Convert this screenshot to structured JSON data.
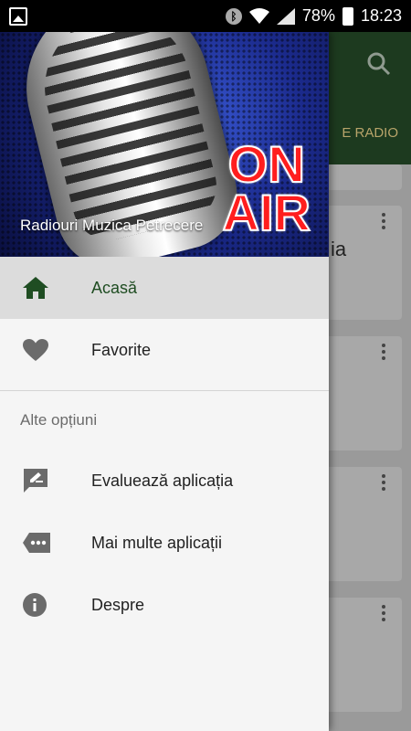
{
  "statusbar": {
    "battery": "78%",
    "time": "18:23"
  },
  "background_app": {
    "tab_label": "E RADIO",
    "partial_text": "ia"
  },
  "drawer": {
    "header_title": "Radiouri Muzica Petrecere",
    "header_logo_text": [
      "ON",
      "AIR"
    ],
    "items": [
      {
        "label": "Acasă",
        "icon": "home-icon",
        "active": true
      },
      {
        "label": "Favorite",
        "icon": "heart-icon",
        "active": false
      }
    ],
    "section_title": "Alte opțiuni",
    "more_items": [
      {
        "label": "Evaluează aplicația",
        "icon": "rate-icon"
      },
      {
        "label": "Mai multe aplicații",
        "icon": "more-apps-icon"
      },
      {
        "label": "Despre",
        "icon": "info-icon"
      }
    ]
  },
  "colors": {
    "accent": "#1f4d22",
    "appbar": "#1d3a1f",
    "icon_gray": "#6b6b6b"
  }
}
